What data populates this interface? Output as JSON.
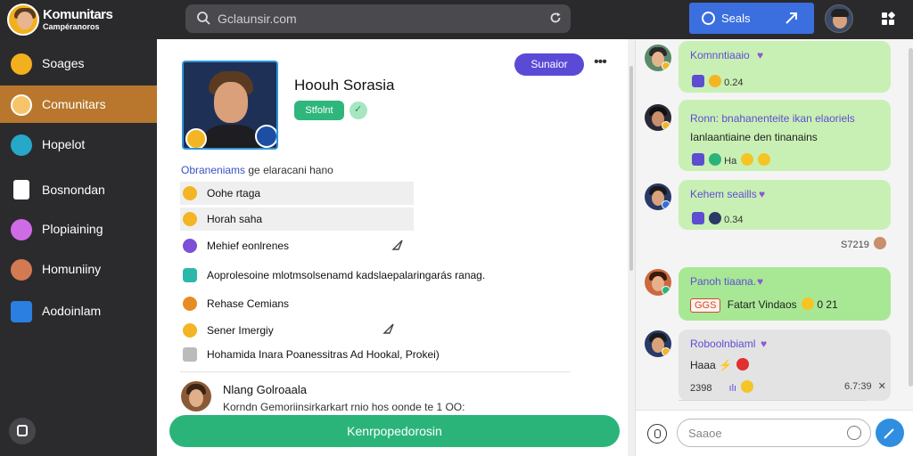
{
  "app": {
    "title": "Komunitars",
    "subtitle": "Campéranoros"
  },
  "search": {
    "placeholder": "Gclaunsir.com"
  },
  "top_button": {
    "label": "Seals"
  },
  "colors": {
    "accent_active": "#b8772d",
    "primary_blue": "#3b6fe0",
    "green": "#2bb47a",
    "purple": "#5b4ad6"
  },
  "sidebar": {
    "items": [
      {
        "label": "Soages",
        "icon": "heart-icon",
        "color": "#f2b01e"
      },
      {
        "label": "Comunitars",
        "icon": "globe-icon",
        "color": "#f7c46a",
        "active": true
      },
      {
        "label": "Hopelot",
        "icon": "compass-icon",
        "color": "#27a8c9"
      },
      {
        "label": "Bosnondan",
        "icon": "document-icon",
        "color": "#ffffff"
      },
      {
        "label": "Plopiaining",
        "icon": "heart-icon",
        "color": "#d06be6"
      },
      {
        "label": "Homuniiny",
        "icon": "person-icon",
        "color": "#d37a52"
      },
      {
        "label": "Aodoinlam",
        "icon": "chart-icon",
        "color": "#2b7fe0"
      }
    ]
  },
  "profile": {
    "name": "Hoouh Sorasia",
    "status": "Stfolnt",
    "subscribe_label": "Sunaior",
    "section_label_prefix": "Obraneniams",
    "section_label_rest": " ge elaracani hano"
  },
  "list": [
    {
      "label": "Oohe rtaga",
      "highlight": true
    },
    {
      "label": "Horah saha",
      "highlight": true
    },
    {
      "label": "Mehief eonlrenes",
      "highlight": false
    },
    {
      "label": "Aoprolesoine mlotmsolsenamd kadslaepalaringarás ranag.",
      "highlight": false
    },
    {
      "label": "Rehase Cemians",
      "highlight": false
    },
    {
      "label": "Sener Imergiy",
      "highlight": false
    },
    {
      "label": "Hohamida Inara Poanessitras Ad Hookal, Prokei)",
      "highlight": false
    }
  ],
  "comment": {
    "author": "Nlang Golroaala",
    "text": "Korndn Gemoriinsirkarkart rnio hos oonde te 1 OO:"
  },
  "main_button": {
    "label": "Kenrpopedorosin"
  },
  "chat": {
    "messages": [
      {
        "name": "Komnntiaaio",
        "meta": "0.24",
        "lines": []
      },
      {
        "name": "",
        "lines": [
          "Ronn: bnahanenteite ikan elaoriels",
          "Ianlaantiaine den tinanains"
        ],
        "meta": "Ha"
      },
      {
        "name": "Kehem seaills",
        "meta": "0.34",
        "time": "S7219"
      },
      {
        "name": "Panoh tiaana.",
        "chip": "GGS",
        "line": "Fatart Vindaos",
        "time2": "0 21"
      },
      {
        "name": "Roboolnbiaml",
        "line": "Haaa",
        "meta": "2398",
        "time": "6.7:39"
      }
    ],
    "composer_placeholder": "Saaoe"
  }
}
